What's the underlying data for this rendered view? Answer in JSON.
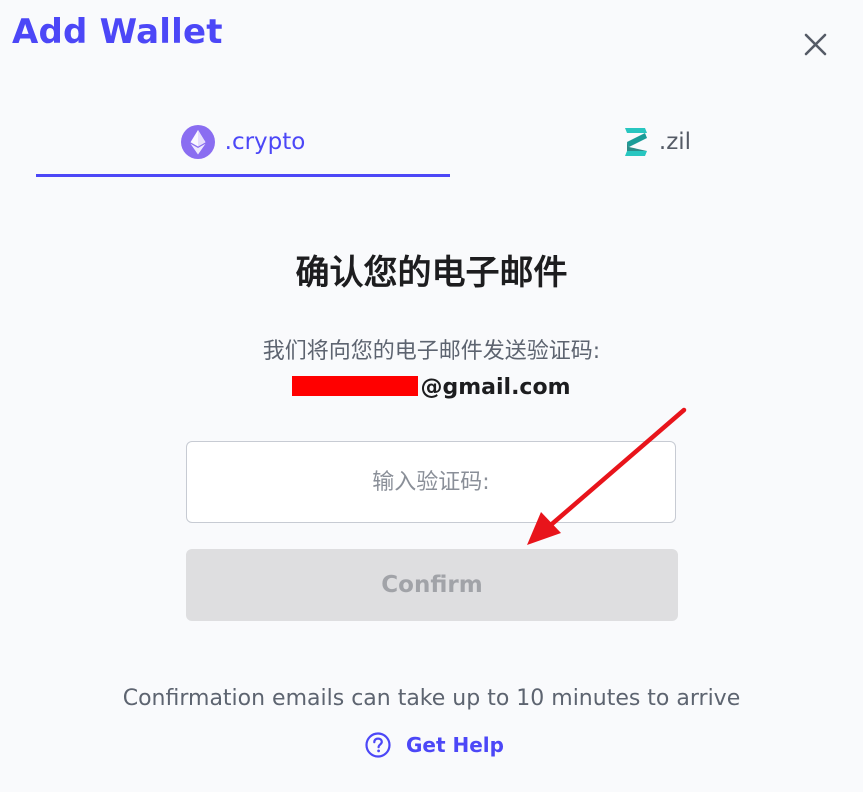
{
  "dialog": {
    "title": "Add Wallet",
    "close_icon": "close-icon"
  },
  "tabs": [
    {
      "label": ".crypto",
      "icon": "ethereum-icon",
      "active": true
    },
    {
      "label": ".zil",
      "icon": "zilliqa-icon",
      "active": false
    }
  ],
  "verify": {
    "heading": "确认您的电子邮件",
    "subtext": "我们将向您的电子邮件发送验证码:",
    "email_suffix": "@gmail.com",
    "code_placeholder": "输入验证码:",
    "confirm_label": "Confirm",
    "footnote": "Confirmation emails can take up to 10 minutes to arrive",
    "help_label": "Get Help",
    "help_icon": "question-circle-icon"
  },
  "colors": {
    "accent": "#4c47f7",
    "annotation_arrow": "#e8141b",
    "redaction": "#ff0000"
  }
}
